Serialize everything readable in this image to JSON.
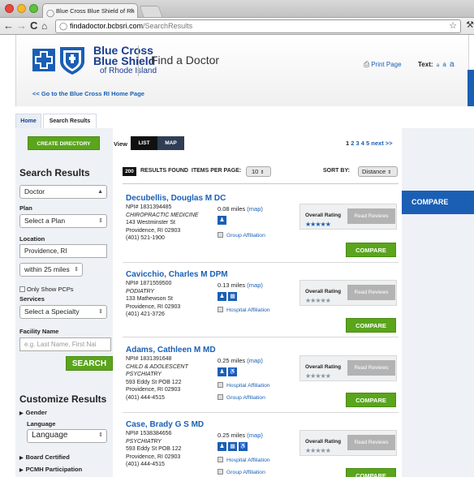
{
  "browser": {
    "tab_title": "Blue Cross Blue Shield of Rh",
    "url_host": "findadoctor.bcbsri.com",
    "url_path": "/SearchResults"
  },
  "header": {
    "brand_line1": "Blue Cross",
    "brand_line2": "Blue Shield",
    "brand_line3": "of Rhode Island",
    "page_heading": "Find a Doctor",
    "print_label": "Print Page",
    "text_label": "Text:",
    "text_sizes": [
      "a",
      "a",
      "a"
    ],
    "go_back": "<< Go to the Blue Cross RI Home Page"
  },
  "breadcrumb": {
    "home": "Home",
    "current": "Search Results"
  },
  "left": {
    "create_directory": "CREATE DIRECTORY",
    "search_results_title": "Search Results",
    "type_select": "Doctor",
    "plan_label": "Plan",
    "plan_select": "Select a Plan",
    "location_label": "Location",
    "location_value": "Providence, RI",
    "radius_select": "within 25 miles",
    "pcp_checkbox": "Only Show PCPs",
    "services_label": "Services",
    "specialty_select": "Select a Specialty",
    "facility_label": "Facility Name",
    "facility_placeholder": "e.g. Last Name, First Nai",
    "search_button": "SEARCH",
    "customize_title": "Customize Results",
    "gender_label": "Gender",
    "language_label": "Language",
    "language_select": "Language",
    "board_certified": "Board Certified",
    "pcmh": "PCMH Participation"
  },
  "view": {
    "label": "View",
    "list": "LIST",
    "map": "MAP"
  },
  "pager": {
    "current": "1",
    "pages": "2 3 4 5",
    "next": "next >>"
  },
  "results": {
    "count": "200",
    "found_label": "RESULTS FOUND",
    "per_page_label": "ITEMS PER PAGE:",
    "per_page_value": "10",
    "sort_label": "SORT BY:",
    "sort_value": "Distance"
  },
  "side": {
    "compare": "COMPARE"
  },
  "cards": [
    {
      "name": "Decubellis, Douglas M DC",
      "npi": "NPI# 1831394485",
      "specialty": "CHIROPRACTIC MEDICINE",
      "specialty2": "",
      "street": "143 Westminster St",
      "city": "Providence, RI 02903",
      "phone": "(401) 521-1900",
      "distance": "0.08 miles",
      "map": "(map)",
      "affiliations": [
        "Group Affiliation"
      ],
      "icons": [
        "person-icon"
      ],
      "rating_label": "Overall Rating",
      "read_reviews": "Read Reviews",
      "stars": "★★★★★",
      "compare": "COMPARE"
    },
    {
      "name": "Cavicchio, Charles M DPM",
      "npi": "NPI# 1871559500",
      "specialty": "PODIATRY",
      "specialty2": "",
      "street": "133 Mathewson St",
      "city": "Providence, RI 02903",
      "phone": "(401) 421-3726",
      "distance": "0.13 miles",
      "map": "(map)",
      "affiliations": [
        "Hospital Affiliation"
      ],
      "icons": [
        "person-icon",
        "grid-icon"
      ],
      "rating_label": "Overall Rating",
      "read_reviews": "Read Reviews",
      "stars": "★★★★★",
      "compare": "COMPARE"
    },
    {
      "name": "Adams, Cathleen M MD",
      "npi": "NPI# 1831391648",
      "specialty": "CHILD & ADOLESCENT",
      "specialty2": "PSYCHIATRY",
      "street": "593 Eddy St POB 122",
      "city": "Providence, RI 02903",
      "phone": "(401) 444-4515",
      "distance": "0.25 miles",
      "map": "(map)",
      "affiliations": [
        "Hospital Affiliation",
        "Group Affiliation"
      ],
      "icons": [
        "person-icon",
        "wheelchair-icon"
      ],
      "rating_label": "Overall Rating",
      "read_reviews": "Read Reviews",
      "stars": "★★★★★",
      "compare": "COMPARE"
    },
    {
      "name": "Case, Brady G S MD",
      "npi": "NPI# 1538384656",
      "specialty": "PSYCHIATRY",
      "specialty2": "",
      "street": "593 Eddy St POB 122",
      "city": "Providence, RI 02903",
      "phone": "(401) 444-4515",
      "distance": "0.25 miles",
      "map": "(map)",
      "affiliations": [
        "Hospital Affiliation",
        "Group Affiliation"
      ],
      "icons": [
        "person-icon",
        "grid-icon",
        "wheelchair-icon"
      ],
      "rating_label": "Overall Rating",
      "read_reviews": "Read Reviews",
      "stars": "★★★★★",
      "compare": "COMPARE"
    }
  ]
}
